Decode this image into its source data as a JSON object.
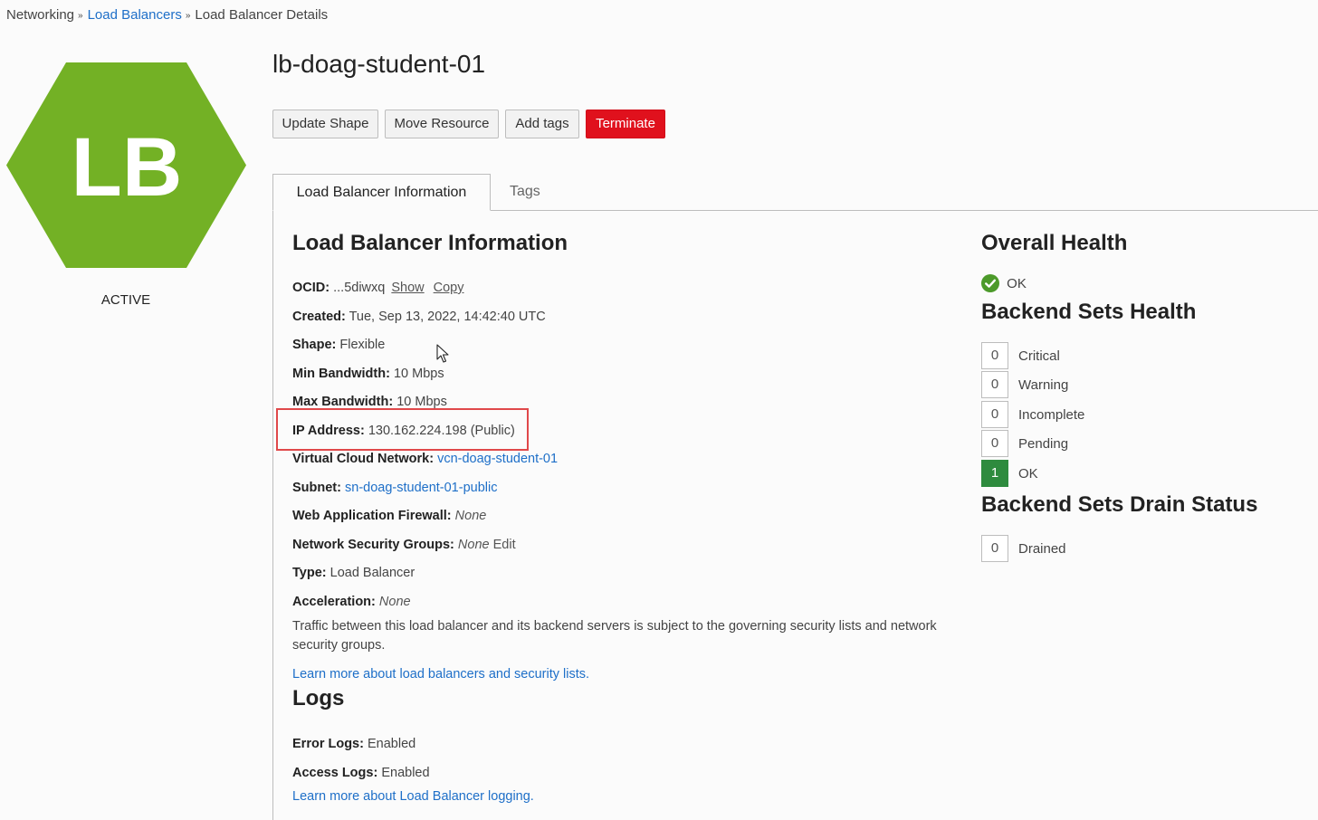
{
  "breadcrumb": {
    "items": [
      {
        "label": "Networking"
      },
      {
        "label": "Load Balancers"
      },
      {
        "label": "Load Balancer Details"
      }
    ]
  },
  "resource": {
    "icon_text": "LB",
    "status": "ACTIVE",
    "name": "lb-doag-student-01"
  },
  "actions": {
    "update_shape": "Update Shape",
    "move_resource": "Move Resource",
    "add_tags": "Add tags",
    "terminate": "Terminate"
  },
  "tabs": [
    {
      "label": "Load Balancer Information",
      "active": true
    },
    {
      "label": "Tags",
      "active": false
    }
  ],
  "info": {
    "heading": "Load Balancer Information",
    "ocid": {
      "label": "OCID:",
      "value": "...5diwxq",
      "show": "Show",
      "copy": "Copy"
    },
    "created": {
      "label": "Created:",
      "value": "Tue, Sep 13, 2022, 14:42:40 UTC"
    },
    "shape": {
      "label": "Shape:",
      "value": "Flexible"
    },
    "min_bandwidth": {
      "label": "Min Bandwidth:",
      "value": "10 Mbps"
    },
    "max_bandwidth": {
      "label": "Max Bandwidth:",
      "value": "10 Mbps"
    },
    "ip_address": {
      "label": "IP Address:",
      "value": "130.162.224.198 (Public)"
    },
    "vcn": {
      "label": "Virtual Cloud Network:",
      "value": "vcn-doag-student-01"
    },
    "subnet": {
      "label": "Subnet:",
      "value": "sn-doag-student-01-public"
    },
    "waf": {
      "label": "Web Application Firewall:",
      "value": "None"
    },
    "nsg": {
      "label": "Network Security Groups:",
      "value": "None",
      "edit": "Edit"
    },
    "type": {
      "label": "Type:",
      "value": "Load Balancer"
    },
    "acceleration": {
      "label": "Acceleration:",
      "value": "None"
    },
    "note": "Traffic between this load balancer and its backend servers is subject to the governing security lists and network security groups.",
    "learn_more": "Learn more about load balancers and security lists."
  },
  "logs": {
    "heading": "Logs",
    "error": {
      "label": "Error Logs:",
      "value": "Enabled"
    },
    "access": {
      "label": "Access Logs:",
      "value": "Enabled"
    },
    "learn_more": "Learn more about Load Balancer logging."
  },
  "health": {
    "overall_heading": "Overall Health",
    "overall_status": "OK",
    "backend_heading": "Backend Sets Health",
    "backend": [
      {
        "count": "0",
        "label": "Critical"
      },
      {
        "count": "0",
        "label": "Warning"
      },
      {
        "count": "0",
        "label": "Incomplete"
      },
      {
        "count": "0",
        "label": "Pending"
      },
      {
        "count": "1",
        "label": "OK"
      }
    ],
    "drain_heading": "Backend Sets Drain Status",
    "drain": {
      "count": "0",
      "label": "Drained"
    }
  },
  "colors": {
    "hex_green": "#73b125",
    "terminate_red": "#e0111d",
    "ok_green": "#2e8b3e",
    "link_blue": "#1e6fc8",
    "highlight_red": "#e0484a"
  }
}
